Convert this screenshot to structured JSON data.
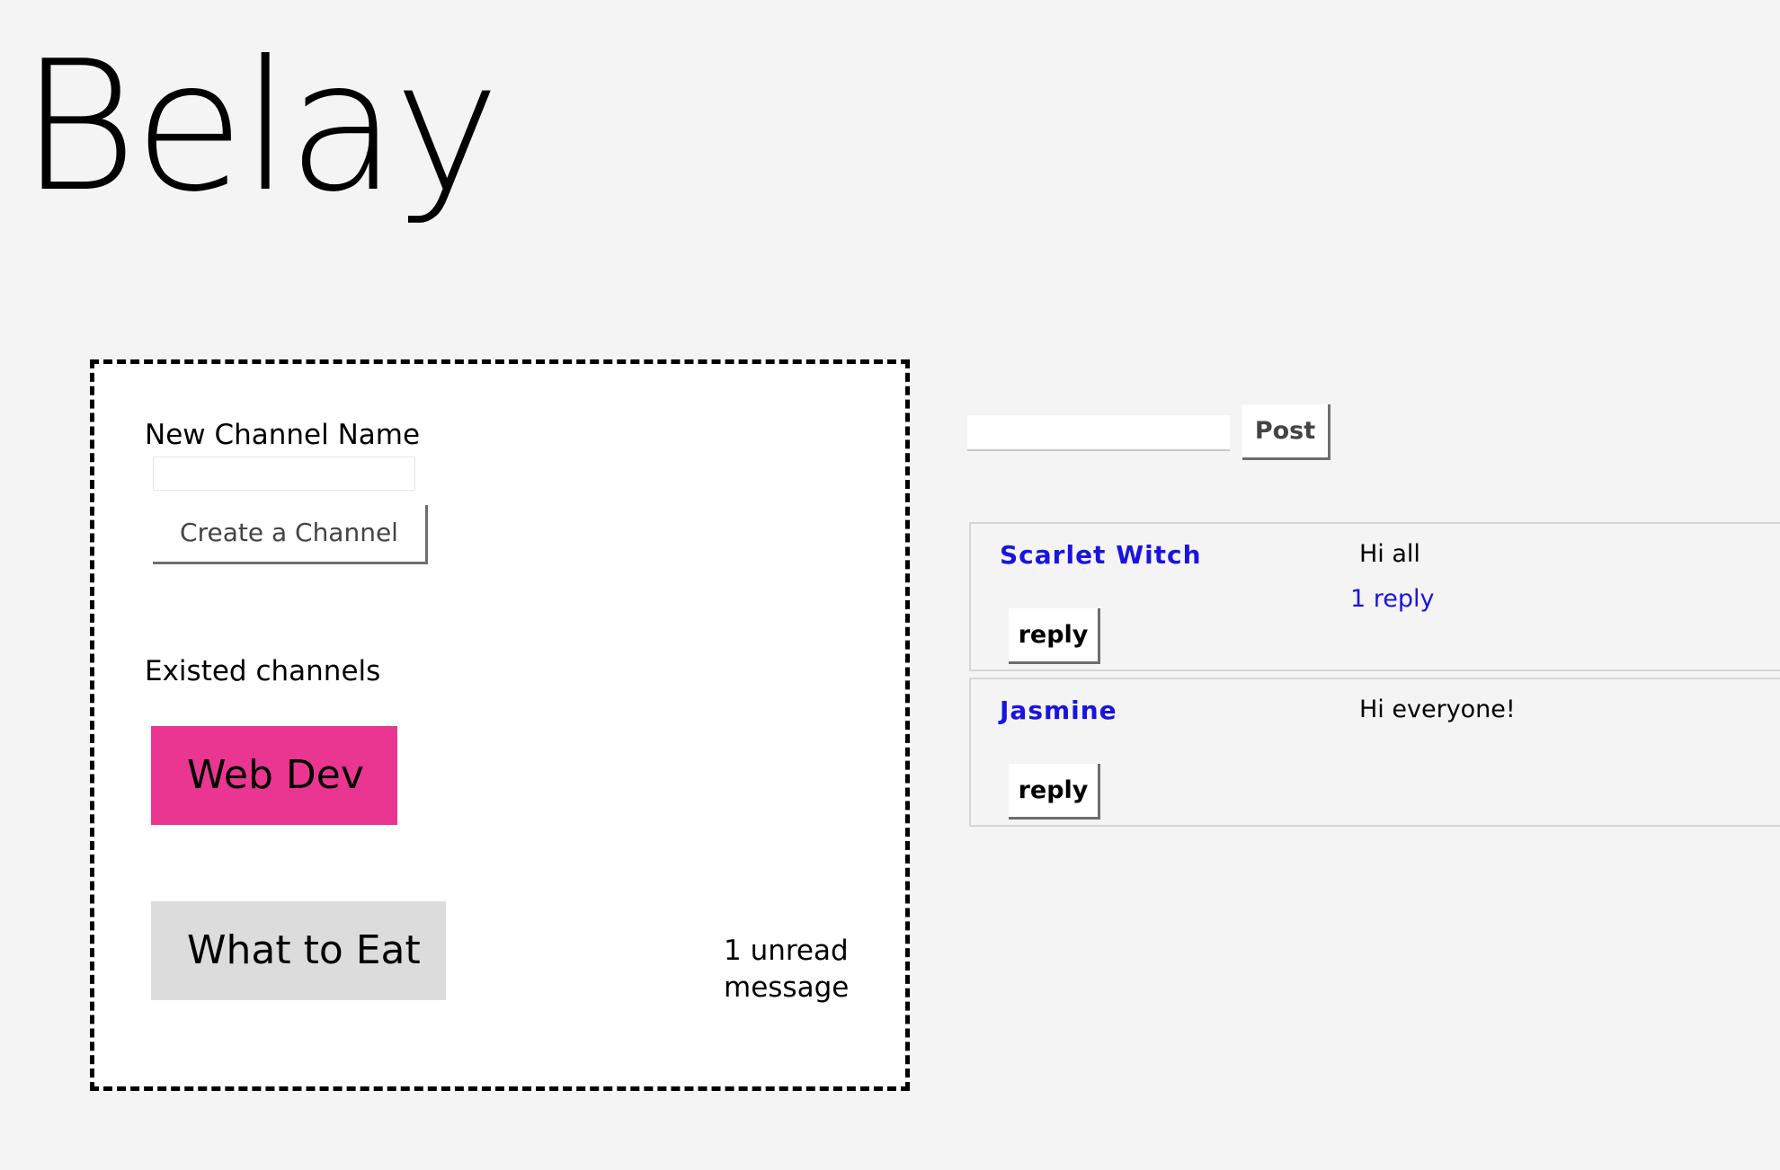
{
  "app": {
    "title": "Belay"
  },
  "channels_panel": {
    "new_channel_label": "New Channel Name",
    "new_channel_input_value": "",
    "create_button_label": "Create a Channel",
    "existed_label": "Existed channels",
    "channels": [
      {
        "name": "Web Dev",
        "selected": true,
        "color": "#ea3690"
      },
      {
        "name": "What to Eat",
        "selected": false,
        "color": "#dcdcdc",
        "unread": "1 unread message"
      }
    ]
  },
  "composer": {
    "input_value": "",
    "post_label": "Post"
  },
  "messages": [
    {
      "author": "Scarlet Witch",
      "text": "Hi all",
      "replies": "1 reply",
      "reply_label": "reply"
    },
    {
      "author": "Jasmine",
      "text": "Hi everyone!",
      "replies": "",
      "reply_label": "reply"
    }
  ],
  "colors": {
    "author_link": "#1a14e0",
    "background": "#f4f4f4"
  }
}
